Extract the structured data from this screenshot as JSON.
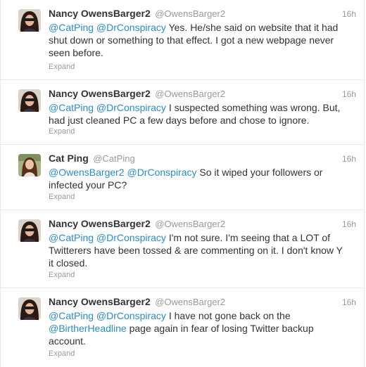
{
  "tweets": [
    {
      "fullname": "Nancy OwensBarger2",
      "username": "@OwensBarger2",
      "time": "16h",
      "mentions": [
        "@CatPing",
        "@DrConspiracy"
      ],
      "text": " Yes. He/she said on website that it had shut down or something to that effect. I got a new webpage never seen before.",
      "expand": "Expand",
      "avatar": "nancy-avatar"
    },
    {
      "fullname": "Nancy OwensBarger2",
      "username": "@OwensBarger2",
      "time": "16h",
      "mentions": [
        "@CatPing",
        "@DrConspiracy"
      ],
      "text": " I suspected something was wrong. But, had just cleaned PC a few days before and chose to ignore.",
      "expand": "Expand",
      "avatar": "nancy-avatar"
    },
    {
      "fullname": "Cat Ping",
      "username": "@CatPing",
      "time": "16h",
      "mentions": [
        "@OwensBarger2",
        "@DrConspiracy"
      ],
      "text": " So it wiped your followers or infected your PC?",
      "expand": "Expand",
      "avatar": "cat-avatar"
    },
    {
      "fullname": "Nancy OwensBarger2",
      "username": "@OwensBarger2",
      "time": "16h",
      "mentions": [
        "@CatPing",
        "@DrConspiracy"
      ],
      "text": " I'm not sure. I'm seeing that a LOT of Twitterers have been tossed & are commenting on it. I don't know Y it closed.",
      "expand": "Expand",
      "avatar": "nancy-avatar"
    },
    {
      "fullname": "Nancy OwensBarger2",
      "username": "@OwensBarger2",
      "time": "16h",
      "mentions": [
        "@CatPing",
        "@DrConspiracy"
      ],
      "text": " I have not gone back on the",
      "inline_mention": "@BirtherHeadline",
      "text_after": " page again in fear of losing Twitter backup account.",
      "expand": "Expand",
      "avatar": "nancy-avatar"
    }
  ],
  "colors": {
    "link": "#2a8cc7",
    "name": "#333333",
    "muted": "#999999",
    "divider": "#e8e8e8"
  }
}
